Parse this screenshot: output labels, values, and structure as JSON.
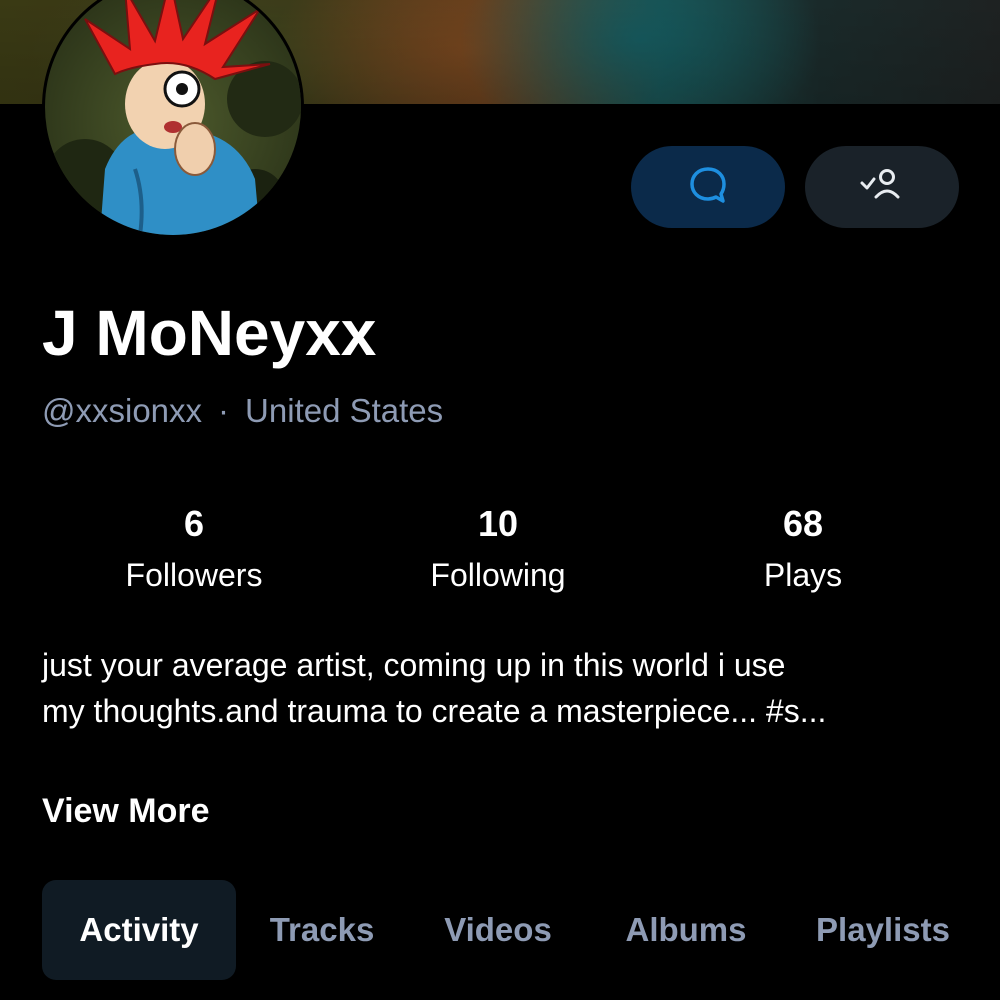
{
  "profile": {
    "name": "J MoNeyxx",
    "handle": "@xxsionxx",
    "separator": "·",
    "location": "United States"
  },
  "actions": {
    "message_icon": "chat-bubble-icon",
    "follow_icon": "user-following-icon"
  },
  "stats": [
    {
      "value": "6",
      "label": "Followers"
    },
    {
      "value": "10",
      "label": "Following"
    },
    {
      "value": "68",
      "label": "Plays"
    }
  ],
  "bio": {
    "line1": "just your average artist,  coming up in this world i use",
    "line2": "my thoughts.and trauma to create a masterpiece... #s..."
  },
  "view_more_label": "View More",
  "tabs": [
    {
      "label": "Activity",
      "active": true
    },
    {
      "label": "Tracks",
      "active": false
    },
    {
      "label": "Videos",
      "active": false
    },
    {
      "label": "Albums",
      "active": false
    },
    {
      "label": "Playlists",
      "active": false
    }
  ],
  "colors": {
    "accent": "#1e8fe0",
    "muted_text": "#8e9bb4",
    "message_button_bg": "#0b2a4a",
    "follow_button_bg": "#1a2229",
    "active_tab_bg": "#101b24"
  }
}
